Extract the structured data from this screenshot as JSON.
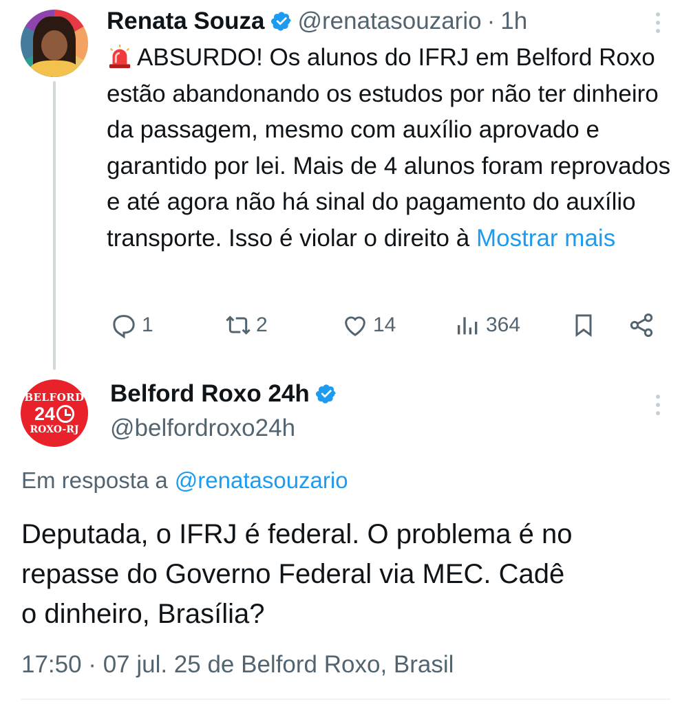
{
  "tweet1": {
    "author_name": "Renata Souza",
    "handle": "@renatasouzario",
    "separator": "·",
    "time": "1h",
    "text": "ABSURDO! Os alunos do IFRJ em Belford Roxo estão abandonando os estudos por não ter dinheiro da passagem, mesmo com auxílio aprovado e garantido por lei. Mais de 4 alunos foram reprovados e até agora não há sinal do pagamento do auxílio transporte. Isso é violar o direito à",
    "show_more": "Mostrar mais",
    "icons": {
      "lead_emoji": "siren-emoji",
      "verified": "verified-badge"
    },
    "actions": {
      "replies": "1",
      "reposts": "2",
      "likes": "14",
      "views": "364"
    }
  },
  "tweet2": {
    "author_name": "Belford Roxo 24h",
    "handle": "@belfordroxo24h",
    "avatar": {
      "line1": "BELFORD",
      "line2": "24",
      "line3": "ROXO-RJ"
    },
    "reply_prefix": "Em resposta a",
    "reply_handle": "@renatasouzario",
    "text_lines": [
      "Deputada, o IFRJ é federal. O problema é no",
      "repasse do Governo Federal via MEC. Cadê",
      "o dinheiro, Brasília?"
    ],
    "timestamp": "17:50 · 07 jul. 25 de Belford Roxo, Brasil"
  },
  "colors": {
    "text": "#0f1419",
    "secondary": "#536471",
    "link": "#1d9bf0",
    "verified": "#1d9bf0",
    "thread_line": "#cfd9de",
    "avatar2_bg": "#e8212a"
  }
}
